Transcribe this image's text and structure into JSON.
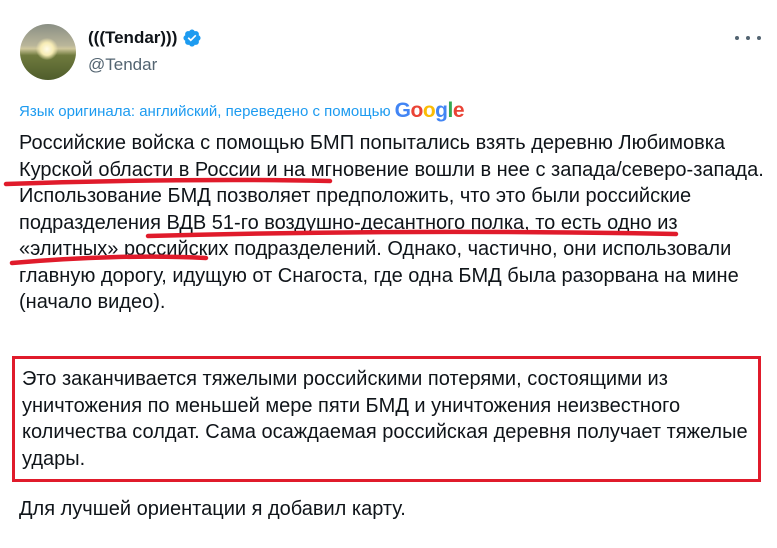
{
  "author": {
    "display_name": "(((Tendar)))",
    "handle": "@Tendar",
    "verified_icon": "verified-badge-icon"
  },
  "translation": {
    "notice": "Язык оригинала: английский, переведено с помощью",
    "provider_logo": "Google",
    "logo_colors": [
      "#4285f4",
      "#ea4335",
      "#fbbc05",
      "#4285f4",
      "#34a853",
      "#ea4335"
    ]
  },
  "tweet": {
    "paragraph1": "Российские войска с помощью БМП попытались взять деревню Любимовка Курской области в России и на мгновение вошли в нее с запада/северо-запада. Использование БМД позволяет предположить, что это были российские подразделения ВДВ 51-го воздушно-десантного полка, то есть одно из «элитных» российских подразделений. Однако, частично, они использовали главную дорогу, идущую от Снагоста, где одна БМД была разорвана на мине (начало видео).",
    "paragraph2": "Это заканчивается тяжелыми российскими потерями, состоящими из уничтожения по меньшей мере пяти БМД и уничтожения неизвестного количества солдат. Сама осаждаемая российская деревня получает тяжелые удары.",
    "paragraph3": "Для лучшей ориентации я добавил карту."
  },
  "colors": {
    "annotation_red": "#e01b2b",
    "link_blue": "#1d9bf0",
    "verified_blue": "#1d9bf0",
    "secondary_text": "#536471"
  }
}
